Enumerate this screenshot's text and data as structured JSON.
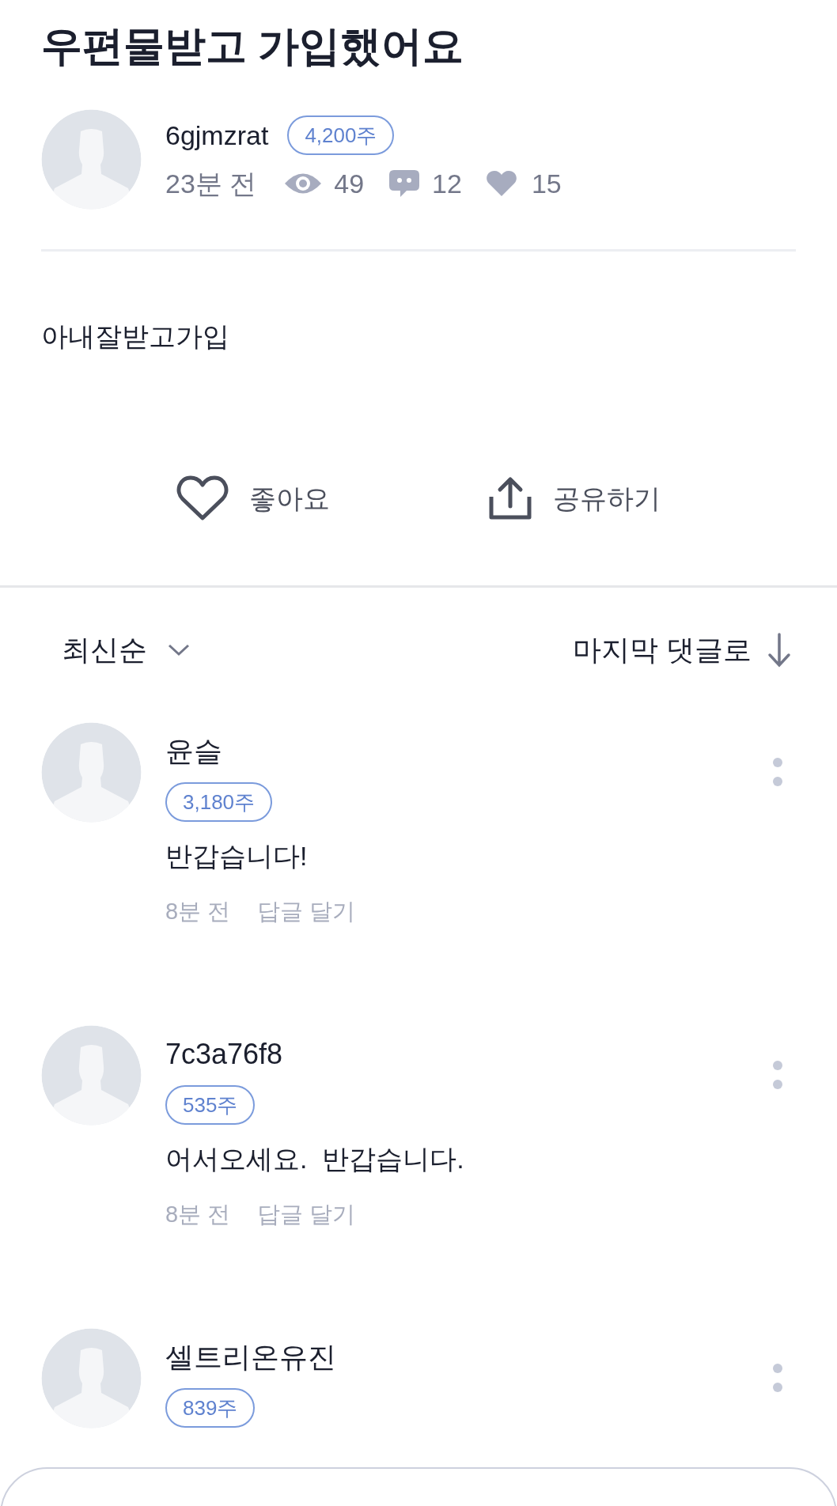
{
  "post": {
    "title": "우편물받고 가입했어요",
    "author": "6gjmzrat",
    "shares": "4,200주",
    "time": "23분 전",
    "views": "49",
    "comments": "12",
    "likes": "15",
    "body": "아내잘받고가입"
  },
  "actions": [
    {
      "kind": "like",
      "label": "좋아요"
    },
    {
      "kind": "share",
      "label": "공유하기"
    }
  ],
  "sort": {
    "order": "최신순",
    "jump": "마지막 댓글로"
  },
  "comments": [
    {
      "author": "윤슬",
      "shares": "3,180주",
      "text": "반갑습니다!",
      "time": "8분 전",
      "reply": "답글 달기"
    },
    {
      "author": "7c3a76f8",
      "shares": "535주",
      "text": "어서오세요.  반갑습니다.",
      "time": "8분 전",
      "reply": "답글 달기"
    },
    {
      "author": "셀트리온유진",
      "shares": "839주"
    }
  ]
}
